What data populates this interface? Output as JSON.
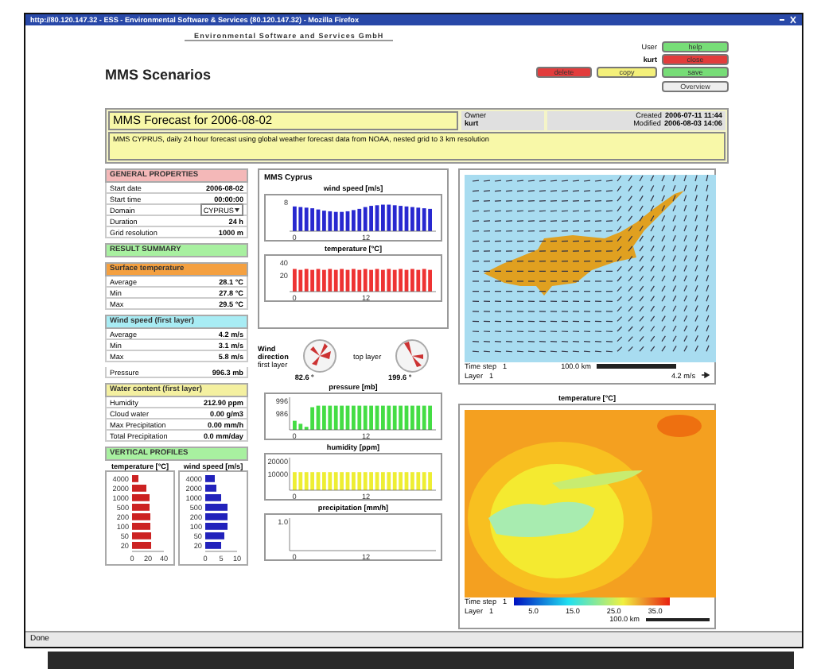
{
  "browser": {
    "title": "http://80.120.147.32 - ESS - Environmental Software & Services (80.120.147.32) - Mozilla Firefox",
    "status": "Done"
  },
  "header": {
    "company": "Environmental Software and Services GmbH",
    "heading": "MMS Scenarios",
    "user_label": "User",
    "user": "kurt"
  },
  "actions": {
    "stack": [
      {
        "label": "help",
        "color": "#77dd77"
      },
      {
        "label": "close",
        "color": "#e23c3c"
      },
      {
        "label": "save",
        "color": "#77dd77"
      }
    ],
    "inline": [
      {
        "label": "delete",
        "color": "#e23c3c"
      },
      {
        "label": "copy",
        "color": "#f4f07a"
      }
    ],
    "overview": "Overview"
  },
  "scenario": {
    "title": "MMS Forecast for 2006-08-02",
    "owner_label": "Owner",
    "owner": "kurt",
    "created_label": "Created",
    "created": "2006-07-11 11:44",
    "modified_label": "Modified",
    "modified": "2006-08-03 14:06",
    "description": "MMS CYPRUS, daily 24 hour forecast using global weather forecast data from NOAA, nested grid to 3 km resolution"
  },
  "sections": [
    {
      "title": "GENERAL PROPERTIES",
      "color": "#f4b8b8",
      "rows": [
        {
          "label": "Start date",
          "value": "2006-08-02"
        },
        {
          "label": "Start time",
          "value": "00:00:00"
        },
        {
          "label": "Domain",
          "select": "CYPRUS"
        },
        {
          "label": "Duration",
          "value": "24 h"
        },
        {
          "label": "Grid resolution",
          "value": "1000 m"
        }
      ]
    },
    {
      "title": "RESULT SUMMARY",
      "color": "#a8f0a0"
    },
    {
      "title": "Surface temperature",
      "color": "#f4a040",
      "rows": [
        {
          "label": "Average",
          "value": "28.1 °C"
        },
        {
          "label": "Min",
          "value": "27.8 °C"
        },
        {
          "label": "Max",
          "value": "29.5 °C"
        }
      ]
    },
    {
      "title": "Wind speed (first layer)",
      "color": "#a8ecf4",
      "rows": [
        {
          "label": "Average",
          "value": "4.2 m/s"
        },
        {
          "label": "Min",
          "value": "3.1 m/s"
        },
        {
          "label": "Max",
          "value": "5.8 m/s"
        }
      ]
    },
    {
      "rows": [
        {
          "label": "Pressure",
          "value": "996.3 mb"
        }
      ]
    },
    {
      "title": "Water content (first layer)",
      "color": "#f4f0a0",
      "rows": [
        {
          "label": "Humidity",
          "value": "212.90 ppm"
        },
        {
          "label": "Cloud water",
          "value": "0.00 g/m3"
        },
        {
          "label": "Max Precipitation",
          "value": "0.00 mm/h"
        },
        {
          "label": "Total Precipitation",
          "value": "0.0 mm/day"
        }
      ]
    }
  ],
  "profiles": {
    "title": "VERTICAL PROFILES",
    "color": "#a8f0a0",
    "charts": [
      {
        "chart_data": {
          "type": "bar",
          "orientation": "horizontal",
          "title": "temperature [°C]",
          "categories": [
            "4000",
            "2000",
            "1000",
            "500",
            "200",
            "100",
            "50",
            "20"
          ],
          "xticks": [
            0,
            20,
            40
          ],
          "xlim": [
            0,
            40
          ],
          "series": [
            {
              "color": "#cc2222",
              "values": [
                8,
                18,
                22,
                22,
                23,
                23,
                24,
                24
              ]
            }
          ]
        }
      },
      {
        "chart_data": {
          "type": "bar",
          "orientation": "horizontal",
          "title": "wind speed [m/s]",
          "categories": [
            "4000",
            "2000",
            "1000",
            "500",
            "200",
            "100",
            "50",
            "20"
          ],
          "xticks": [
            0,
            5,
            10
          ],
          "xlim": [
            0,
            10
          ],
          "series": [
            {
              "color": "#2222bb",
              "values": [
                3,
                3.5,
                5,
                7,
                7,
                7,
                6,
                5
              ]
            }
          ]
        }
      }
    ]
  },
  "mms": {
    "title": "MMS Cyprus",
    "charts": [
      {
        "title": "wind speed [m/s]",
        "color": "#2828d0",
        "yticks": [
          "8"
        ],
        "xticks": [
          "0",
          "12"
        ]
      },
      {
        "title": "temperature [°C]",
        "color": "#ee3333",
        "yticks": [
          "40",
          "20"
        ],
        "xticks": [
          "0",
          "12"
        ]
      }
    ]
  },
  "wind_direction": {
    "label": "Wind direction",
    "first_layer": "first layer",
    "first_value": "82.6 °",
    "top_layer": "top layer",
    "top_value": "199.6 °"
  },
  "charts": [
    {
      "title": "pressure [mb]",
      "color": "#44dd44",
      "yticks": [
        "996",
        "986"
      ],
      "xticks": [
        "0",
        "12"
      ]
    },
    {
      "title": "humidity [ppm]",
      "color": "#eeee33",
      "yticks": [
        "20000",
        "10000"
      ],
      "xticks": [
        "0",
        "12"
      ]
    },
    {
      "title": "precipitation [mm/h]",
      "yticks": [
        "1.0"
      ],
      "xticks": [
        "0",
        "12"
      ]
    }
  ],
  "wind_map": {
    "time_label": "Time step",
    "time_value": "1",
    "layer_label": "Layer",
    "layer_value": "1",
    "scale": "100.0 km",
    "speed": "4.2 m/s"
  },
  "temp_map": {
    "title": "temperature [°C]",
    "time_label": "Time step",
    "time_value": "1",
    "layer_label": "Layer",
    "layer_value": "1",
    "ticks": [
      "5.0",
      "15.0",
      "25.0",
      "35.0"
    ],
    "scale": "100.0 km"
  }
}
